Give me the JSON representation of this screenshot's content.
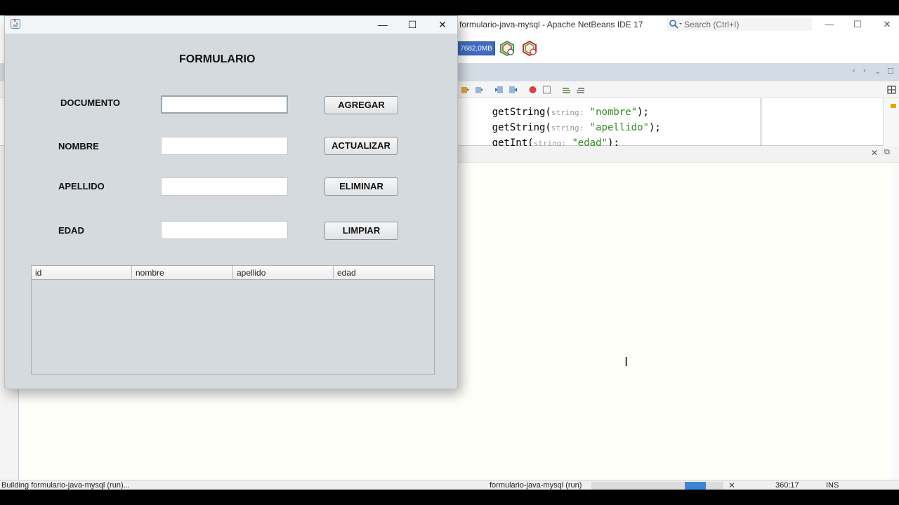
{
  "ide": {
    "title": "formulario-java-mysql - Apache NetBeans IDE 17",
    "search_placeholder": "Search (Ctrl+I)",
    "memory": "7682,0MB",
    "code_lines": [
      {
        "prefix": "getString(",
        "hint": "string:",
        "arg": " \"nombre\"",
        "suffix": ");"
      },
      {
        "prefix": "getString(",
        "hint": "string:",
        "arg": " \"apellido\"",
        "suffix": ");"
      },
      {
        "prefix": "getInt(",
        "hint": "string:",
        "arg": " \"edad\"",
        "suffix": ");"
      }
    ],
    "status": {
      "left": "Building formulario-java-mysql (run)...",
      "task": "formulario-java-mysql (run)",
      "position": "360:17",
      "mode": "INS",
      "progress_fraction_start": 0.71,
      "progress_fraction_end": 0.87
    },
    "colors": {
      "accent": "#3d86d6",
      "string_literal": "#2f8f1f",
      "memory_badge": "#3f6cc1"
    }
  },
  "form": {
    "window_controls": {
      "minimize": "—",
      "maximize": "☐",
      "close": "✕"
    },
    "heading": "FORMULARIO",
    "fields": {
      "documento": {
        "label": "DOCUMENTO",
        "value": ""
      },
      "nombre": {
        "label": "NOMBRE",
        "value": ""
      },
      "apellido": {
        "label": "APELLIDO",
        "value": ""
      },
      "edad": {
        "label": "EDAD",
        "value": ""
      }
    },
    "buttons": {
      "agregar": "AGREGAR",
      "actualizar": "ACTUALIZAR",
      "eliminar": "ELIMINAR",
      "limpiar": "LIMPIAR"
    },
    "table": {
      "columns": [
        "id",
        "nombre",
        "apellido",
        "edad"
      ],
      "rows": []
    }
  }
}
